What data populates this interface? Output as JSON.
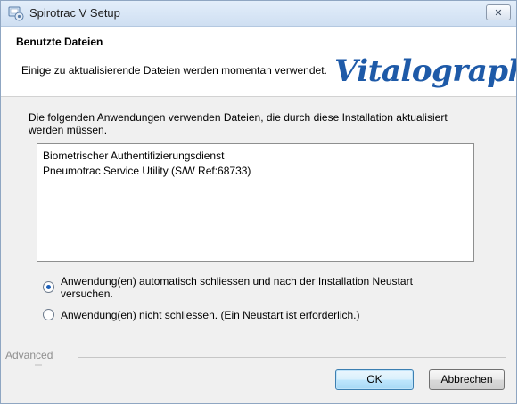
{
  "window": {
    "title": "Spirotrac V Setup",
    "close_label": "✕"
  },
  "header": {
    "title": "Benutzte Dateien",
    "description": "Einige zu aktualisierende Dateien werden momentan verwendet.",
    "logo_text": "Vitalograph",
    "logo_mark": "®"
  },
  "content": {
    "info_text": "Die folgenden Anwendungen verwenden Dateien, die durch diese Installation aktualisiert werden müssen.",
    "applications": [
      "Biometrischer Authentifizierungsdienst",
      "Pneumotrac Service Utility (S/W Ref:68733)"
    ],
    "options": [
      {
        "label": "Anwendung(en) automatisch schliessen und nach der Installation Neustart versuchen.",
        "selected": true
      },
      {
        "label": "Anwendung(en) nicht schliessen. (Ein Neustart ist erforderlich.)",
        "selected": false
      }
    ]
  },
  "footer": {
    "advanced_label": "Advanced",
    "ok_label": "OK",
    "cancel_label": "Abbrechen"
  },
  "colors": {
    "logo": "#1e5aa8",
    "titlebar": "#cfdff2",
    "dialog_bg": "#f0f0f0"
  }
}
